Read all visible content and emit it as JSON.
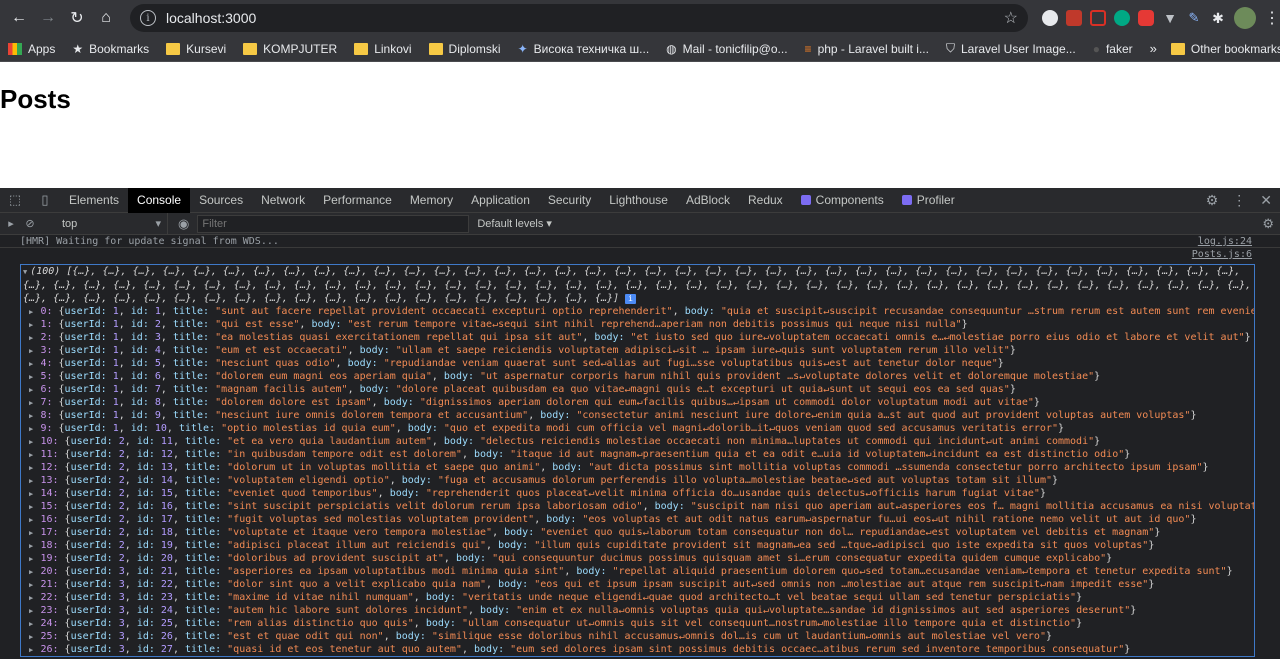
{
  "browser": {
    "url": "localhost:3000",
    "bookmarks": [
      "Apps",
      "Bookmarks",
      "Kursevi",
      "KOMPJUTER",
      "Linkovi",
      "Diplomski",
      "Висока техничка ш...",
      "Mail - tonicfilip@o...",
      "php - Laravel built i...",
      "Laravel User Image...",
      "faker"
    ],
    "bookmarks_more": "»",
    "other_bookmarks": "Other bookmarks"
  },
  "page": {
    "heading": "Posts"
  },
  "devtools": {
    "tabs": [
      "Elements",
      "Console",
      "Sources",
      "Network",
      "Performance",
      "Memory",
      "Application",
      "Security",
      "Lighthouse",
      "AdBlock",
      "Redux",
      "Components",
      "Profiler"
    ],
    "active_tab": "Console",
    "context": "top",
    "filter_placeholder": "Filter",
    "levels": "Default levels ▾"
  },
  "console": {
    "hmr_text": "[HMR] Waiting for update signal from WDS...",
    "hmr_source": "log.js:24",
    "posts_source": "Posts.js:6",
    "array_head": "(100) [{…}, {…}, {…}, {…}, {…}, {…}, {…}, {…}, {…}, {…}, {…}, {…}, {…}, {…}, {…}, {…}, {…}, {…}, {…}, {…}, {…}, {…}, {…}, {…}, {…}, {…}, {…}, {…}, {…}, {…}, {…}, {…}, {…}, {…}, {…}, {…}, {…}, {…}, {…}, {…}, {…}, {…}, {…}, {…}, {…}, {…}, {…}, {…}, {…}, {…}, {…}, {…}, {…}, {…}, {…}, {…}, {…}, {…}, {…}, {…}, {…}, {…}, {…}, {…}, {…}, {…}, {…}, {…}, {…}, {…}, {…}, {…}, {…}, {…}, {…}, {…}, {…}, {…}, {…}, {…}, {…}, {…}, {…}, {…}, {…}, {…}, {…}, {…}, {…}, {…}, {…}, {…}, {…}, {…}, {…}, {…}, {…}, {…}, {…}, {…}]",
    "rows": [
      {
        "i": "0",
        "u": "1",
        "id": "1",
        "title": "\"sunt aut facere repellat provident occaecati excepturi optio reprehenderit\"",
        "body": "\"quia et suscipit↵suscipit recusandae consequuntur …strum rerum est autem sunt rem eveniet architecto\""
      },
      {
        "i": "1",
        "u": "1",
        "id": "2",
        "title": "\"qui est esse\"",
        "body": "\"est rerum tempore vitae↵sequi sint nihil reprehend…aperiam non debitis possimus qui neque nisi nulla\""
      },
      {
        "i": "2",
        "u": "1",
        "id": "3",
        "title": "\"ea molestias quasi exercitationem repellat qui ipsa sit aut\"",
        "body": "\"et iusto sed quo iure↵voluptatem occaecati omnis e…↵molestiae porro eius odio et labore et velit aut\""
      },
      {
        "i": "3",
        "u": "1",
        "id": "4",
        "title": "\"eum et est occaecati\"",
        "body": "\"ullam et saepe reiciendis voluptatem adipisci↵sit … ipsam iure↵quis sunt voluptatem rerum illo velit\""
      },
      {
        "i": "4",
        "u": "1",
        "id": "5",
        "title": "\"nesciunt quas odio\"",
        "body": "\"repudiandae veniam quaerat sunt sed↵alias aut fugi…sse voluptatibus quis↵est aut tenetur dolor neque\""
      },
      {
        "i": "5",
        "u": "1",
        "id": "6",
        "title": "\"dolorem eum magni eos aperiam quia\"",
        "body": "\"ut aspernatur corporis harum nihil quis provident …s↵voluptate dolores velit et doloremque molestiae\""
      },
      {
        "i": "6",
        "u": "1",
        "id": "7",
        "title": "\"magnam facilis autem\"",
        "body": "\"dolore placeat quibusdam ea quo vitae↵magni quis e…t excepturi ut quia↵sunt ut sequi eos ea sed quas\""
      },
      {
        "i": "7",
        "u": "1",
        "id": "8",
        "title": "\"dolorem dolore est ipsam\"",
        "body": "\"dignissimos aperiam dolorem qui eum↵facilis quibus…↵ipsam ut commodi dolor voluptatum modi aut vitae\""
      },
      {
        "i": "8",
        "u": "1",
        "id": "9",
        "title": "\"nesciunt iure omnis dolorem tempora et accusantium\"",
        "body": "\"consectetur animi nesciunt iure dolore↵enim quia a…st aut quod aut provident voluptas autem voluptas\""
      },
      {
        "i": "9",
        "u": "1",
        "id": "10",
        "title": "\"optio molestias id quia eum\"",
        "body": "\"quo et expedita modi cum officia vel magni↵dolorib…it↵quos veniam quod sed accusamus veritatis error\""
      },
      {
        "i": "10",
        "u": "2",
        "id": "11",
        "title": "\"et ea vero quia laudantium autem\"",
        "body": "\"delectus reiciendis molestiae occaecati non minima…luptates ut commodi qui incidunt↵ut animi commodi\""
      },
      {
        "i": "11",
        "u": "2",
        "id": "12",
        "title": "\"in quibusdam tempore odit est dolorem\"",
        "body": "\"itaque id aut magnam↵praesentium quia et ea odit e…uia id voluptatem↵incidunt ea est distinctio odio\""
      },
      {
        "i": "12",
        "u": "2",
        "id": "13",
        "title": "\"dolorum ut in voluptas mollitia et saepe quo animi\"",
        "body": "\"aut dicta possimus sint mollitia voluptas commodi …ssumenda consectetur porro architecto ipsum ipsam\""
      },
      {
        "i": "13",
        "u": "2",
        "id": "14",
        "title": "\"voluptatem eligendi optio\"",
        "body": "\"fuga et accusamus dolorum perferendis illo volupta…molestiae beatae↵sed aut voluptas totam sit illum\""
      },
      {
        "i": "14",
        "u": "2",
        "id": "15",
        "title": "\"eveniet quod temporibus\"",
        "body": "\"reprehenderit quos placeat↵velit minima officia do…usandae quis delectus↵officiis harum fugiat vitae\""
      },
      {
        "i": "15",
        "u": "2",
        "id": "16",
        "title": "\"sint suscipit perspiciatis velit dolorum rerum ipsa laboriosam odio\"",
        "body": "\"suscipit nam nisi quo aperiam aut↵asperiores eos f… magni mollitia accusamus ea nisi voluptate dicta\""
      },
      {
        "i": "16",
        "u": "2",
        "id": "17",
        "title": "\"fugit voluptas sed molestias voluptatem provident\"",
        "body": "\"eos voluptas et aut odit natus earum↵aspernatur fu…ui eos↵ut nihil ratione nemo velit ut aut id quo\""
      },
      {
        "i": "17",
        "u": "2",
        "id": "18",
        "title": "\"voluptate et itaque vero tempora molestiae\"",
        "body": "\"eveniet quo quis↵laborum totam consequatur non dol… repudiandae↵est voluptatem vel debitis et magnam\""
      },
      {
        "i": "18",
        "u": "2",
        "id": "19",
        "title": "\"adipisci placeat illum aut reiciendis qui\"",
        "body": "\"illum quis cupiditate provident sit magnam↵ea sed …tque↵adipisci quo iste expedita sit quos voluptas\""
      },
      {
        "i": "19",
        "u": "2",
        "id": "20",
        "title": "\"doloribus ad provident suscipit at\"",
        "body": "\"qui consequuntur ducimus possimus quisquam amet si…erum consequatur expedita quidem cumque explicabo\""
      },
      {
        "i": "20",
        "u": "3",
        "id": "21",
        "title": "\"asperiores ea ipsam voluptatibus modi minima quia sint\"",
        "body": "\"repellat aliquid praesentium dolorem quo↵sed totam…ecusandae veniam↵tempora et tenetur expedita sunt\""
      },
      {
        "i": "21",
        "u": "3",
        "id": "22",
        "title": "\"dolor sint quo a velit explicabo quia nam\"",
        "body": "\"eos qui et ipsum ipsam suscipit aut↵sed omnis non …molestiae aut atque rem suscipit↵nam impedit esse\""
      },
      {
        "i": "22",
        "u": "3",
        "id": "23",
        "title": "\"maxime id vitae nihil numquam\"",
        "body": "\"veritatis unde neque eligendi↵quae quod architecto…t vel beatae sequi ullam sed tenetur perspiciatis\""
      },
      {
        "i": "23",
        "u": "3",
        "id": "24",
        "title": "\"autem hic labore sunt dolores incidunt\"",
        "body": "\"enim et ex nulla↵omnis voluptas quia qui↵voluptate…sandae id dignissimos aut sed asperiores deserunt\""
      },
      {
        "i": "24",
        "u": "3",
        "id": "25",
        "title": "\"rem alias distinctio quo quis\"",
        "body": "\"ullam consequatur ut↵omnis quis sit vel consequunt…nostrum↵molestiae illo tempore quia et distinctio\""
      },
      {
        "i": "25",
        "u": "3",
        "id": "26",
        "title": "\"est et quae odit qui non\"",
        "body": "\"similique esse doloribus nihil accusamus↵omnis dol…is cum ut laudantium↵omnis aut molestiae vel vero\""
      },
      {
        "i": "26",
        "u": "3",
        "id": "27",
        "title": "\"quasi id et eos tenetur aut quo autem\"",
        "body": "\"eum sed dolores ipsam sint possimus debitis occaec…atibus rerum sed inventore temporibus consequatur\""
      }
    ]
  }
}
